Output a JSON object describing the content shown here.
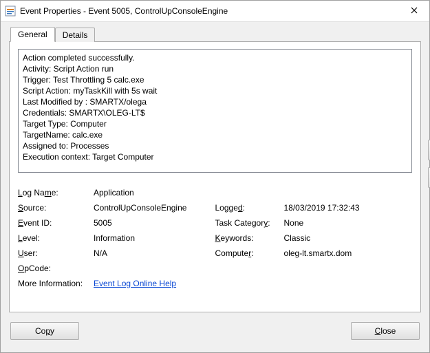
{
  "titlebar": {
    "title": "Event Properties - Event 5005, ControlUpConsoleEngine"
  },
  "tabs": {
    "general": "General",
    "details": "Details",
    "active": "general"
  },
  "description": "Action completed successfully.\nActivity: Script Action run\nTrigger: Test Throttling 5 calc.exe\nScript Action: myTaskKill with 5s wait\nLast Modified by : SMARTX/olega\nCredentials: SMARTX\\OLEG-LT$\nTarget Type: Computer\nTargetName: calc.exe\nAssigned to: Processes\nExecution context: Target Computer",
  "props": {
    "log_name_label": "Log Name:",
    "log_name_value": "Application",
    "source_label": "Source:",
    "source_value": "ControlUpConsoleEngine",
    "logged_label": "Logged:",
    "logged_value": "18/03/2019 17:32:43",
    "event_id_label": "Event ID:",
    "event_id_value": "5005",
    "task_category_label": "Task Category:",
    "task_category_value": "None",
    "level_label": "Level:",
    "level_value": "Information",
    "keywords_label": "Keywords:",
    "keywords_value": "Classic",
    "user_label": "User:",
    "user_value": "N/A",
    "computer_label": "Computer:",
    "computer_value": "oleg-lt.smartx.dom",
    "opcode_label": "OpCode:",
    "opcode_value": "",
    "more_info_label": "More Information:",
    "more_info_link": "Event Log Online Help"
  },
  "buttons": {
    "copy": "Copy",
    "close": "Close"
  }
}
